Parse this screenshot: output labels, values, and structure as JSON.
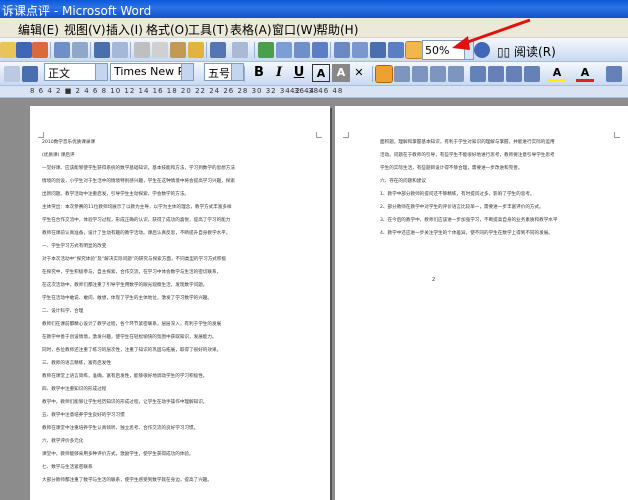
{
  "window": {
    "title": "诉课点评 - Microsoft Word"
  },
  "menu": [
    {
      "label": "编辑(E)",
      "key": "edit"
    },
    {
      "label": "视图(V)",
      "key": "view"
    },
    {
      "label": "插入(I)",
      "key": "insert"
    },
    {
      "label": "格式(O)",
      "key": "format"
    },
    {
      "label": "工具(T)",
      "key": "tools"
    },
    {
      "label": "表格(A)",
      "key": "table"
    },
    {
      "label": "窗口(W)",
      "key": "window"
    },
    {
      "label": "帮助(H)",
      "key": "help"
    }
  ],
  "toolbar": {
    "zoom_value": "50%",
    "read_label": "阅读(R)"
  },
  "format_bar": {
    "style": "正文",
    "font": "Times New Roman",
    "size": "五号",
    "bold": "B",
    "italic": "I",
    "underline": "U",
    "char_border": "A",
    "font_color_letter": "A",
    "highlight_letter": "A"
  },
  "ruler": {
    "left_ticks": "8 6 4 2 ■ 2 4 6 8 10 12 14 16 18 20 22 24 26 28 30 32 34 36 38",
    "right_ticks": "42 44 46 48"
  },
  "page1": {
    "lines": [
      "2010数学音乐优质课录课",
      "(优质课)  课后评",
      "一堂好课、应该能够使学生获得系统的数学基础知识，基本技能和方法，学习到数学的思想方法",
      "情境的创设，小学生对于生活中的情境特别感兴趣，学生在这种情境中将会提高学习兴趣，探索",
      "出新问题。教学活动中注重启发，引导学生主动探索，学会数学的方法。",
      "主体突出：本次参赛的11位教师均展示了以教为主导，以学为主体的理念，教学方式丰富多样",
      "学生在合作交流中，体验学习过程，形成正确的认识，获得了成功的喜悦，提高了学习的能力",
      "教师在课前认真准备，设计了生动有趣的教学活动。课后认真反思，不断提升自身教学水平。",
      "一、学生学习方式有明显的改变",
      "对于本次活动中“探究体验”及“解决实际问题”的研究与探索方面，不同类型的学习方式积极",
      "在探究中，学生积极参与，自主探索，合作交流，在学习中体会数学与生活的密切联系，",
      "在这次活动中，教师们都注重了引导学生用数学的眼光观察生活，发现数学问题。",
      "学生在活动中敢说、敢问、敢想，体现了学生的主体地位，激发了学习数学的兴趣。",
      "二、设计科学、合理",
      "教师们在课前都精心设计了教学过程，各个环节紧密联系，层层深入，有利于学生的发展",
      "在教学中善于创设情境，激发兴趣，使学生在轻松愉快的氛围中获取知识，发展能力。",
      "同时，各位教师还注重了练习的层次性，注重了知识的巩固与拓展，取得了很好的效果。",
      "三、教师的语言精练，富有启发性",
      "教师在课堂上语言简练，准确，富有启发性，能够很好地调动学生的学习积极性。",
      "四、教学中注重知识的形成过程",
      "教学中，教师们能够让学生经历知识的形成过程，让学生在动手操作中理解知识。",
      "五、教学中注意培养学生良好的学习习惯",
      "教师在课堂中注重培养学生认真倾听、独立思考、合作交流的良好学习习惯。",
      "六、教学评价多元化",
      "课堂中，教师能够采用多种评价方式，激励学生，使学生获得成功的体验。",
      "七、数学与生活紧密联系",
      "大部分教师都注重了数学与生活的联系，使学生感受到数学就在身边，提高了兴趣。"
    ]
  },
  "page2": {
    "lines": [
      "面积题，理解和掌握基本知识，有利于学生对知识的理解与掌握，并能进行实际的运用",
      "活动。问题在于教师的引导，有些学生不能很好地进行思考，教师要注意引导学生思考",
      "学生的实际生活，有些题目设计得不够合理，需要进一步改进和完善。",
      "六、存在的问题和建议",
      "1、教学中部分教师的提问还不够精练，有时提问过多，影响了学生的思考。",
      "2、部分教师在教学中对学生的评价语言比较单一，需要进一步丰富评价的方式。",
      "3、在今后的教学中，教师们应该进一步加强学习，不断提高自身的业务素质和教学水平",
      "4、教学中还应进一步关注学生的个体差异，使不同的学生在数学上得到不同的发展。"
    ],
    "page_number": "2"
  }
}
